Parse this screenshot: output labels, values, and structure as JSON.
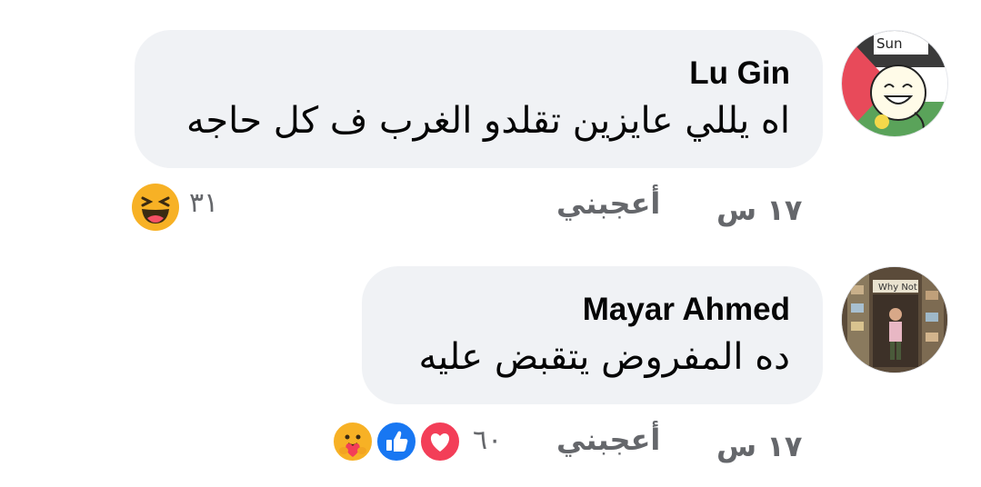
{
  "comments": [
    {
      "author": "Lu Gin",
      "text": "اه يللي عايزين تقلدو الغرب ف كل حاجه",
      "time": "١٧ س",
      "like_label": "أعجبني",
      "reaction_count": "٣١",
      "reactions": [
        "laughing-face"
      ],
      "avatar_text": "Sun"
    },
    {
      "author": "Mayar Ahmed",
      "text": "ده المفروض يتقبض عليه",
      "time": "١٧ س",
      "like_label": "أعجبني",
      "reaction_count": "٦٠",
      "reactions": [
        "love-heart",
        "like-thumb",
        "care-hug"
      ],
      "avatar_text": "Why Not"
    }
  ],
  "colors": {
    "bubble": "#f0f2f5",
    "meta_text": "#65676b",
    "like_blue": "#1877f2",
    "love_red": "#f33e58",
    "haha_yellow": "#f7b125"
  }
}
